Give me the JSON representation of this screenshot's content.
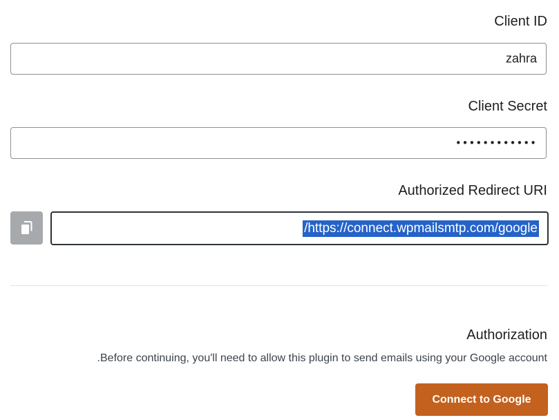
{
  "client_id": {
    "label": "Client ID",
    "value": "zahra"
  },
  "client_secret": {
    "label": "Client Secret",
    "value": "••••••••••••"
  },
  "redirect_uri": {
    "label": "Authorized Redirect URI",
    "value": "/https://connect.wpmailsmtp.com/google",
    "copy_icon": "copy-icon"
  },
  "authorization": {
    "heading": "Authorization",
    "description": ".Before continuing, you'll need to allow this plugin to send emails using your Google account",
    "button_label": "Connect to Google"
  },
  "colors": {
    "button_bg": "#c3611e",
    "selection_bg": "#2563c9",
    "copy_button_bg": "#a7aaad"
  }
}
